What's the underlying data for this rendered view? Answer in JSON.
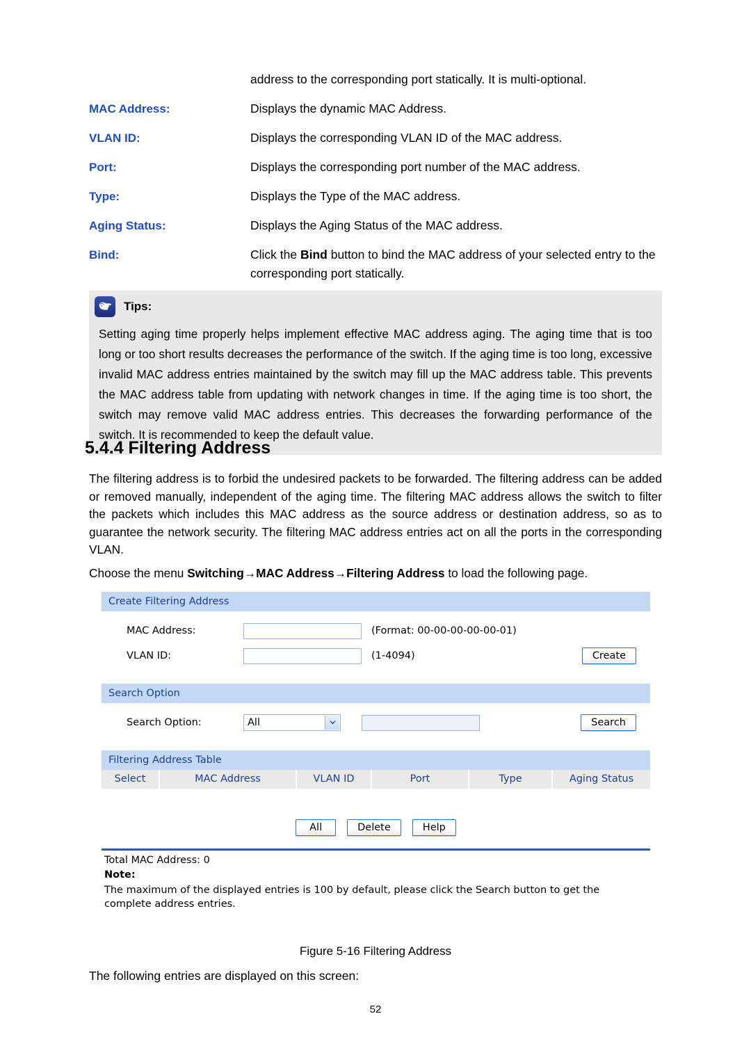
{
  "definitions": {
    "intro": "address to the corresponding port statically. It is multi-optional.",
    "rows": [
      {
        "term": "MAC Address:",
        "desc": "Displays the dynamic MAC Address."
      },
      {
        "term": "VLAN ID:",
        "desc": "Displays the corresponding VLAN ID of the MAC address."
      },
      {
        "term": "Port:",
        "desc": "Displays the corresponding port number of the MAC address."
      },
      {
        "term": "Type:",
        "desc": "Displays the Type of the MAC address."
      },
      {
        "term": "Aging Status:",
        "desc": "Displays the Aging Status of the MAC address."
      },
      {
        "term": "Bind:",
        "desc_pre": "Click the ",
        "desc_bold": "Bind",
        "desc_post": " button to bind the MAC address of your selected entry to the corresponding port statically."
      }
    ]
  },
  "tips": {
    "icon": "pointing-hand-icon",
    "label": "Tips:",
    "body": "Setting aging time properly helps implement effective MAC address aging. The aging time that is too long or too short results decreases the performance of the switch. If the aging time is too long, excessive invalid MAC address entries maintained by the switch may fill up the MAC address table. This prevents the MAC address table from updating with network changes in time. If the aging time is too short, the switch may remove valid MAC address entries. This decreases the forwarding performance of the switch. It is recommended to keep the default value."
  },
  "section": {
    "heading": "5.4.4 Filtering Address",
    "paragraph_1": "The filtering address is to forbid the undesired packets to be forwarded. The filtering address can be added or removed manually, independent of the aging time. The filtering MAC address allows the switch to filter the packets which includes this MAC address as the source address or destination address, so as to guarantee the network security. The filtering MAC address entries act on all the ports in the corresponding VLAN.",
    "paragraph_2_pre": "Choose the menu ",
    "paragraph_2_bold": "Switching→MAC Address→Filtering Address",
    "paragraph_2_post": " to load the following page."
  },
  "ui": {
    "create_panel": {
      "title": "Create Filtering Address",
      "mac_label": "MAC Address:",
      "mac_value": "",
      "mac_hint": "(Format: 00-00-00-00-00-01)",
      "vlan_label": "VLAN ID:",
      "vlan_value": "",
      "vlan_hint": "(1-4094)",
      "create_button": "Create"
    },
    "search_panel": {
      "title": "Search Option",
      "label": "Search Option:",
      "selected": "All",
      "options": [
        "All"
      ],
      "text_value": "",
      "search_button": "Search",
      "arrow_icon": "chevron-down-icon"
    },
    "table_panel": {
      "title": "Filtering Address Table",
      "columns": [
        "Select",
        "MAC Address",
        "VLAN ID",
        "Port",
        "Type",
        "Aging Status"
      ],
      "rows": [],
      "buttons": [
        "All",
        "Delete",
        "Help"
      ]
    },
    "footer": {
      "total": "Total MAC Address: 0",
      "note_label": "Note:",
      "note_text": "The maximum of the displayed entries is 100 by default, please click the Search button to get the complete address entries."
    }
  },
  "figure_caption": "Figure 5-16 Filtering Address",
  "closing_text": "The following entries are displayed on this screen:",
  "page_number": "52",
  "colors": {
    "term_blue": "#1f4ec4",
    "panel_header_bg": "#c3d8f5",
    "panel_header_text": "#1b3f8f",
    "table_header_bg": "#e9e9e9",
    "rule_blue": "#2f5f9e",
    "tips_bg": "#e8e8e8"
  }
}
